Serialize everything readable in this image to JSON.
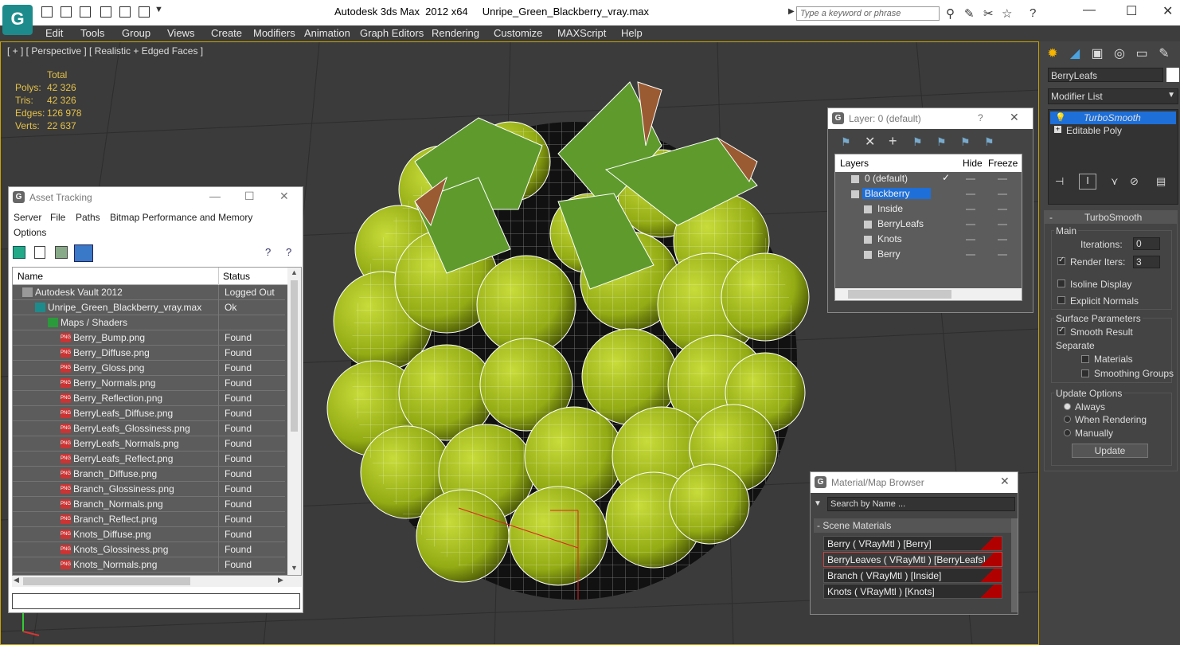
{
  "titlebar": {
    "title": "Autodesk 3ds Max  2012 x64     Unripe_Green_Blackberry_vray.max",
    "search_placeholder": "Type a keyword or phrase",
    "icons": [
      "new-icon",
      "open-icon",
      "save-icon",
      "undo-icon",
      "redo-icon",
      "binoculars-icon",
      "tools-icon",
      "star-icon",
      "help-icon"
    ]
  },
  "menubar": {
    "items": [
      "Edit",
      "Tools",
      "Group",
      "Views",
      "Create",
      "Modifiers",
      "Animation",
      "Graph Editors",
      "Rendering",
      "Customize",
      "MAXScript",
      "Help"
    ]
  },
  "viewport": {
    "label": "[ + ] [ Perspective ] [ Realistic + Edged Faces ]",
    "stats_header": "Total",
    "stats": [
      {
        "label": "Polys:",
        "value": "42 326"
      },
      {
        "label": "Tris:",
        "value": "42 326"
      },
      {
        "label": "Edges:",
        "value": "126 978"
      },
      {
        "label": "Verts:",
        "value": "22 637"
      }
    ]
  },
  "command_panel": {
    "object_name": "BerryLeafs",
    "modifier_list_label": "Modifier List",
    "stack": [
      {
        "label": "TurboSmooth",
        "selected": true
      },
      {
        "label": "Editable Poly",
        "selected": false
      }
    ],
    "rollout_title": "TurboSmooth",
    "main_group": "Main",
    "iterations_label": "Iterations:",
    "iterations_value": "0",
    "render_iters_label": "Render Iters:",
    "render_iters_value": "3",
    "isoline_label": "Isoline Display",
    "explicit_label": "Explicit Normals",
    "surface_group": "Surface Parameters",
    "smooth_result_label": "Smooth Result",
    "separate_label": "Separate",
    "materials_label": "Materials",
    "smoothing_label": "Smoothing Groups",
    "update_group": "Update Options",
    "always_label": "Always",
    "when_rendering_label": "When Rendering",
    "manually_label": "Manually",
    "update_button": "Update"
  },
  "asset_tracking": {
    "title": "Asset Tracking",
    "menu": [
      "Server",
      "File",
      "Paths",
      "Bitmap Performance and Memory",
      "Options"
    ],
    "col_name": "Name",
    "col_status": "Status",
    "rows": [
      {
        "name": "Autodesk Vault 2012",
        "status": "Logged Out ...",
        "indent": 0,
        "icon": "vault"
      },
      {
        "name": "Unripe_Green_Blackberry_vray.max",
        "status": "Ok",
        "indent": 1,
        "icon": "max"
      },
      {
        "name": "Maps / Shaders",
        "status": "",
        "indent": 2,
        "icon": "maps"
      },
      {
        "name": "Berry_Bump.png",
        "status": "Found",
        "indent": 3,
        "icon": "png"
      },
      {
        "name": "Berry_Diffuse.png",
        "status": "Found",
        "indent": 3,
        "icon": "png"
      },
      {
        "name": "Berry_Gloss.png",
        "status": "Found",
        "indent": 3,
        "icon": "png"
      },
      {
        "name": "Berry_Normals.png",
        "status": "Found",
        "indent": 3,
        "icon": "png"
      },
      {
        "name": "Berry_Reflection.png",
        "status": "Found",
        "indent": 3,
        "icon": "png"
      },
      {
        "name": "BerryLeafs_Diffuse.png",
        "status": "Found",
        "indent": 3,
        "icon": "png"
      },
      {
        "name": "BerryLeafs_Glossiness.png",
        "status": "Found",
        "indent": 3,
        "icon": "png"
      },
      {
        "name": "BerryLeafs_Normals.png",
        "status": "Found",
        "indent": 3,
        "icon": "png"
      },
      {
        "name": "BerryLeafs_Reflect.png",
        "status": "Found",
        "indent": 3,
        "icon": "png"
      },
      {
        "name": "Branch_Diffuse.png",
        "status": "Found",
        "indent": 3,
        "icon": "png"
      },
      {
        "name": "Branch_Glossiness.png",
        "status": "Found",
        "indent": 3,
        "icon": "png"
      },
      {
        "name": "Branch_Normals.png",
        "status": "Found",
        "indent": 3,
        "icon": "png"
      },
      {
        "name": "Branch_Reflect.png",
        "status": "Found",
        "indent": 3,
        "icon": "png"
      },
      {
        "name": "Knots_Diffuse.png",
        "status": "Found",
        "indent": 3,
        "icon": "png"
      },
      {
        "name": "Knots_Glossiness.png",
        "status": "Found",
        "indent": 3,
        "icon": "png"
      },
      {
        "name": "Knots_Normals.png",
        "status": "Found",
        "indent": 3,
        "icon": "png"
      }
    ]
  },
  "layer_window": {
    "title": "Layer: 0 (default)",
    "help": "?",
    "col_layers": "Layers",
    "col_hide": "Hide",
    "col_freeze": "Freeze",
    "rows": [
      {
        "name": "0 (default)",
        "indent": 0,
        "selected": false,
        "check": true
      },
      {
        "name": "Blackberry",
        "indent": 0,
        "selected": true,
        "check": false
      },
      {
        "name": "Inside",
        "indent": 1,
        "selected": false,
        "check": false
      },
      {
        "name": "BerryLeafs",
        "indent": 1,
        "selected": false,
        "check": false
      },
      {
        "name": "Knots",
        "indent": 1,
        "selected": false,
        "check": false
      },
      {
        "name": "Berry",
        "indent": 1,
        "selected": false,
        "check": false
      }
    ]
  },
  "material_browser": {
    "title": "Material/Map Browser",
    "search_placeholder": "Search by Name ...",
    "section": "- Scene Materials",
    "items": [
      {
        "label": "Berry  ( VRayMtl ) [Berry]",
        "selected": false
      },
      {
        "label": "BerryLeaves  ( VRayMtl ) [BerryLeafs]",
        "selected": true
      },
      {
        "label": "Branch  ( VRayMtl ) [Inside]",
        "selected": false
      },
      {
        "label": "Knots  ( VRayMtl ) [Knots]",
        "selected": false
      }
    ]
  },
  "colors": {
    "viewport_bg": "#3b3b3b",
    "berry_green": "#a6c21a",
    "stat_yellow": "#e5c24a",
    "selection_blue": "#1e6fd8",
    "material_red": "#b00000"
  }
}
